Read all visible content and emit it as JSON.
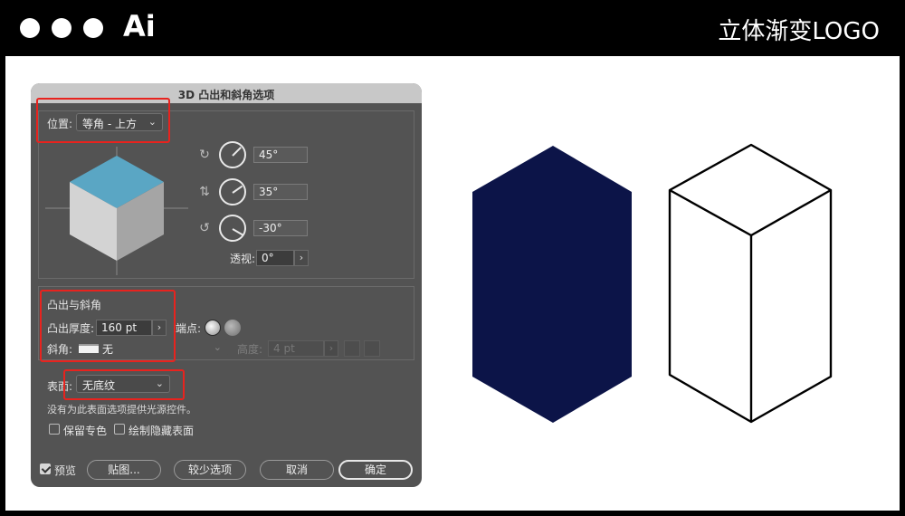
{
  "header": {
    "app_name": "Ai",
    "title": "立体渐变LOGO"
  },
  "dialog": {
    "title": "3D 凸出和斜角选项",
    "position": {
      "label": "位置:",
      "value": "等角 - 上方"
    },
    "rotation": {
      "x_angle": "45°",
      "y_angle": "35°",
      "z_angle": "-30°",
      "perspective_label": "透视:",
      "perspective_value": "0°"
    },
    "extrude_bevel": {
      "section_label": "凸出与斜角",
      "depth_label": "凸出厚度:",
      "depth_value": "160 pt",
      "cap_label": "端点:",
      "bevel_label": "斜角:",
      "bevel_value": "无",
      "height_label": "高度:",
      "height_value": "4 pt"
    },
    "surface": {
      "label": "表面:",
      "value": "无底纹",
      "note": "没有为此表面选项提供光源控件。"
    },
    "options": {
      "preserve_spot": "保留专色",
      "draw_hidden": "绘制隐藏表面"
    },
    "footer": {
      "preview_label": "预览",
      "preview_checked": true,
      "map_button": "贴图...",
      "fewer_options_button": "较少选项",
      "cancel_button": "取消",
      "ok_button": "确定"
    }
  },
  "colors": {
    "cube_top": "#5aa6c4",
    "cube_left": "#d3d3d3",
    "cube_right": "#a5a5a5",
    "hexagon_fill": "#0c1448",
    "highlight_box": "#e8231e"
  }
}
